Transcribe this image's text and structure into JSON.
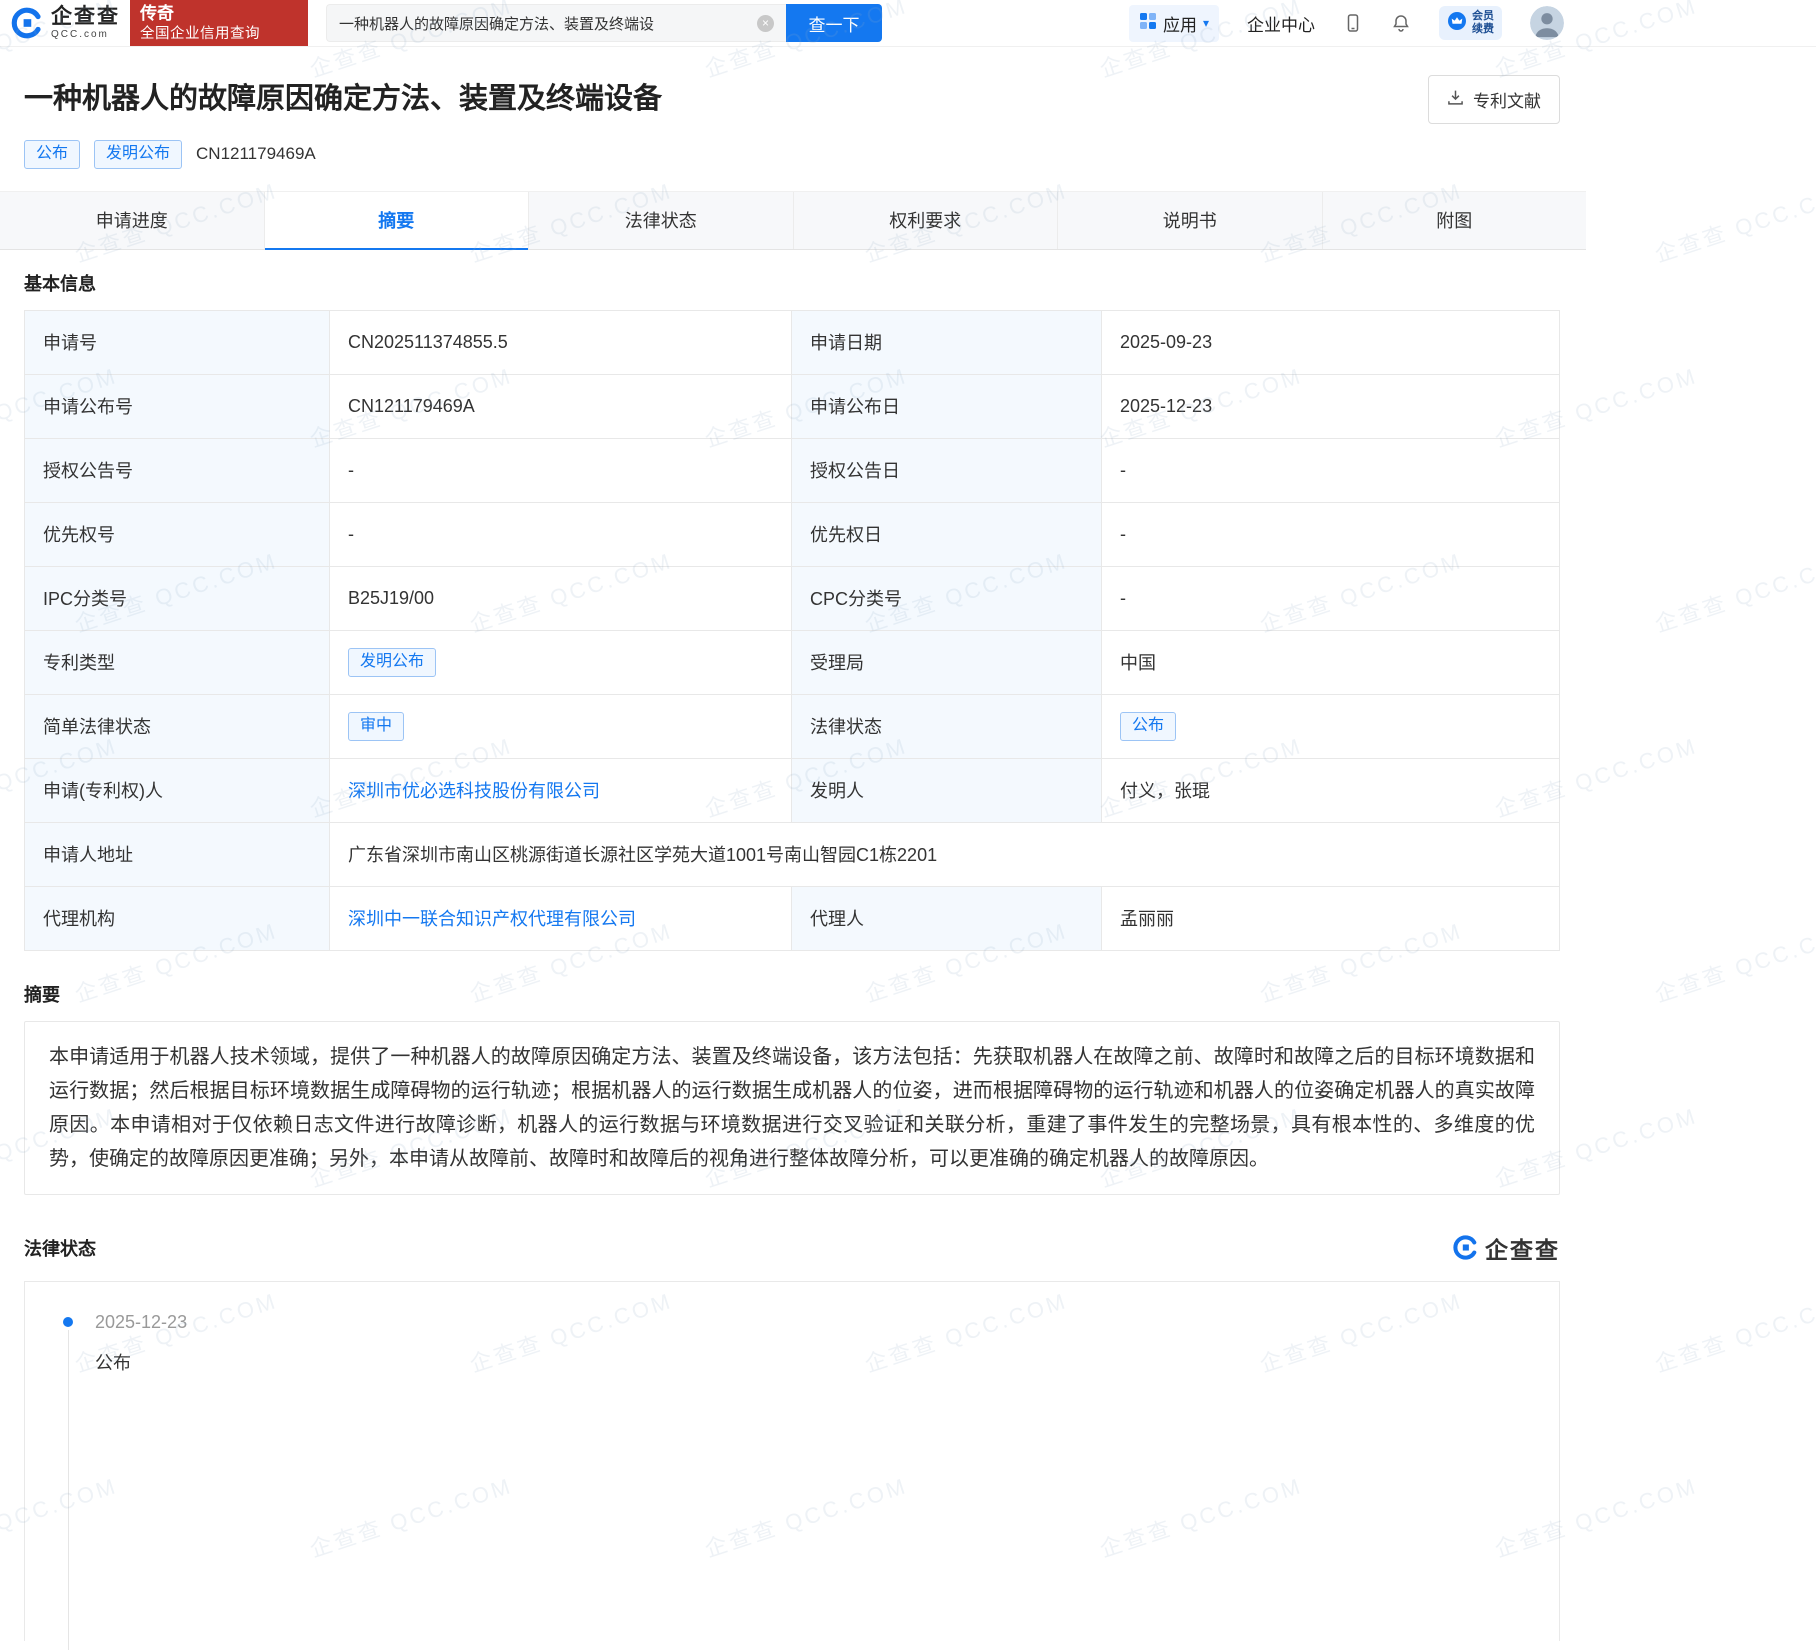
{
  "colors": {
    "accent_blue": "#1478f0",
    "promo_red": "#bf332c",
    "label_cell_bg": "#f4f9fe",
    "tag_border": "#9cc4f5",
    "tag_bg": "#f0f7ff"
  },
  "icons": {
    "clear": "×",
    "caret_down": "▾"
  },
  "watermark": "企查查 QCC.COM",
  "header": {
    "logo_name": "企查查",
    "logo_domain": "QCC.com",
    "promo_line1": "传奇",
    "promo_line2": "全国企业信用查询",
    "search": {
      "value": "一种机器人的故障原因确定方法、装置及终端设",
      "button": "查一下"
    },
    "nav_apps": "应用",
    "nav_enterprise": "企业中心",
    "member_line1": "会员",
    "member_line2": "续费"
  },
  "title_bar": {
    "title": "一种机器人的故障原因确定方法、装置及终端设备",
    "tag_publish": "公布",
    "tag_type": "发明公布",
    "publication_no": "CN121179469A",
    "doc_button": "专利文献"
  },
  "tabs": {
    "items": [
      {
        "label": "申请进度"
      },
      {
        "label": "摘要"
      },
      {
        "label": "法律状态"
      },
      {
        "label": "权利要求"
      },
      {
        "label": "说明书"
      },
      {
        "label": "附图"
      }
    ],
    "active": "摘要"
  },
  "basic_info": {
    "heading": "基本信息",
    "rows": [
      {
        "l1": "申请号",
        "v1": "CN202511374855.5",
        "l2": "申请日期",
        "v2": "2025-09-23"
      },
      {
        "l1": "申请公布号",
        "v1": "CN121179469A",
        "l2": "申请公布日",
        "v2": "2025-12-23"
      },
      {
        "l1": "授权公告号",
        "v1": "-",
        "l2": "授权公告日",
        "v2": "-"
      },
      {
        "l1": "优先权号",
        "v1": "-",
        "l2": "优先权日",
        "v2": "-"
      },
      {
        "l1": "IPC分类号",
        "v1": "B25J19/00",
        "l2": "CPC分类号",
        "v2": "-"
      },
      {
        "l1": "专利类型",
        "v1": "发明公布",
        "l2": "受理局",
        "v2": "中国"
      },
      {
        "l1": "简单法律状态",
        "v1": "审中",
        "l2": "法律状态",
        "v2": "公布"
      },
      {
        "l1": "申请(专利权)人",
        "v1": "深圳市优必选科技股份有限公司",
        "l2": "发明人",
        "v2": "付义，张琨"
      },
      {
        "l1": "申请人地址",
        "v1": "广东省深圳市南山区桃源街道长源社区学苑大道1001号南山智园C1栋2201"
      },
      {
        "l1": "代理机构",
        "v1": "深圳中一联合知识产权代理有限公司",
        "l2": "代理人",
        "v2": "孟丽丽"
      }
    ]
  },
  "abstract": {
    "heading": "摘要",
    "text": "本申请适用于机器人技术领域，提供了一种机器人的故障原因确定方法、装置及终端设备，该方法包括：先获取机器人在故障之前、故障时和故障之后的目标环境数据和运行数据；然后根据目标环境数据生成障碍物的运行轨迹；根据机器人的运行数据生成机器人的位姿，进而根据障碍物的运行轨迹和机器人的位姿确定机器人的真实故障原因。本申请相对于仅依赖日志文件进行故障诊断，机器人的运行数据与环境数据进行交叉验证和关联分析，重建了事件发生的完整场景，具有根本性的、多维度的优势，使确定的故障原因更准确；另外，本申请从故障前、故障时和故障后的视角进行整体故障分析，可以更准确的确定机器人的故障原因。"
  },
  "legal_status": {
    "heading": "法律状态",
    "brand": "企查查",
    "items": [
      {
        "date": "2025-12-23",
        "status": "公布"
      }
    ]
  }
}
